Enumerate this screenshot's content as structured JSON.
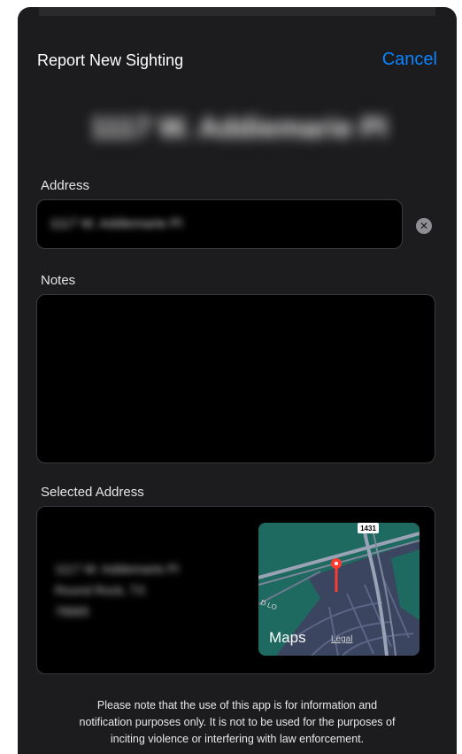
{
  "header": {
    "title": "Report New Sighting",
    "cancel_label": "Cancel",
    "headline": "1117 W. Addiemarie Pl"
  },
  "form": {
    "address_label": "Address",
    "address_value": "1117 W. Addiemarie Pl",
    "notes_label": "Notes",
    "notes_value": "",
    "selected_label": "Selected Address"
  },
  "selected_address": {
    "line1": "1117 W. Addiemarie Pl",
    "line2": "Round Rock, TX",
    "line3": "78665"
  },
  "map": {
    "road_shield": "1431",
    "road_label": "D LO",
    "logo_text": "Maps",
    "legal_label": "Legal"
  },
  "disclaimer": {
    "line1": "Please note that the use of this app is for information and",
    "line2": "notification purposes only. It is not to be used for the purposes of",
    "line3": "inciting violence or interfering with law enforcement."
  },
  "colors": {
    "accent": "#0a84ff",
    "background": "#1c1c1e",
    "field": "#000000",
    "pin": "#ff3b30",
    "map_green": "#1e6a60",
    "map_blue": "#3b4560"
  },
  "icons": {
    "clear": "clear-x-icon",
    "pin": "map-pin-icon",
    "apple": "apple-logo-icon"
  }
}
